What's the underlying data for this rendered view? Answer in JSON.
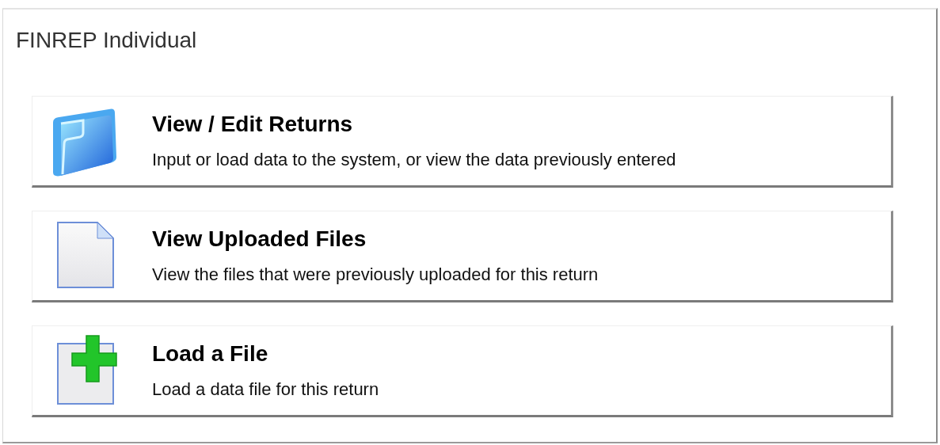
{
  "panel": {
    "title": "FINREP Individual"
  },
  "actions": [
    {
      "kind": "folder",
      "title": "View / Edit Returns",
      "description": "Input or load data to the system, or view the data previously entered"
    },
    {
      "kind": "document",
      "title": "View Uploaded Files",
      "description": "View the files that were previously uploaded for this return"
    },
    {
      "kind": "add",
      "title": "Load a File",
      "description": "Load a data file for this return"
    }
  ]
}
